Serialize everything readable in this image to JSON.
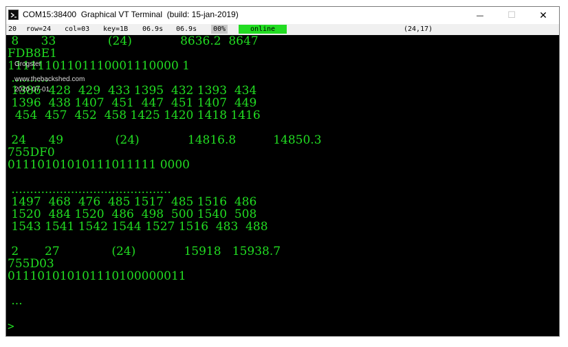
{
  "window": {
    "title": "COM15:38400  Graphical VT Terminal  (build: 15-jan-2019)",
    "buttons": {
      "minimize": "—",
      "maximize": "☐",
      "close": "✕"
    }
  },
  "status": {
    "field1": "20",
    "row": "row=24",
    "col": "col=03",
    "key": "key=1B",
    "time1": "06.9s",
    "time2": "06.9s",
    "percent": "00%",
    "state": "online",
    "cursor": "(24,17)"
  },
  "watermark": {
    "name": "Grogster",
    "site": "www.thebackshed.com",
    "date": "2020-07-01"
  },
  "terminal": {
    "lines": [
      " 8      33              (24)             8636.2  8647",
      "FDB8E1",
      "11111101101110001110000 1",
      " ..........",
      " 1386  428  429  433 1395  432 1393  434",
      " 1396  438 1407  451  447  451 1407  449",
      "  454  457  452  458 1425 1420 1418 1416",
      "",
      " 24      49              (24)             14816.8          14850.3",
      "755DF0",
      "01110101010111011111 0000",
      "",
      " ...........................................",
      " 1497  468  476  485 1517  485 1516  486",
      " 1520  484 1520  486  498  500 1540  508",
      " 1543 1541 1542 1544 1527 1516  483  488",
      "",
      " 2       27              (24)             15918   15938.7",
      "755D03",
      "011101010101110100000011",
      "",
      " ...",
      ""
    ],
    "prompt": ">"
  },
  "colors": {
    "terminal_fg": "#22dd22",
    "terminal_bg": "#000000",
    "online": "#22dd22"
  }
}
